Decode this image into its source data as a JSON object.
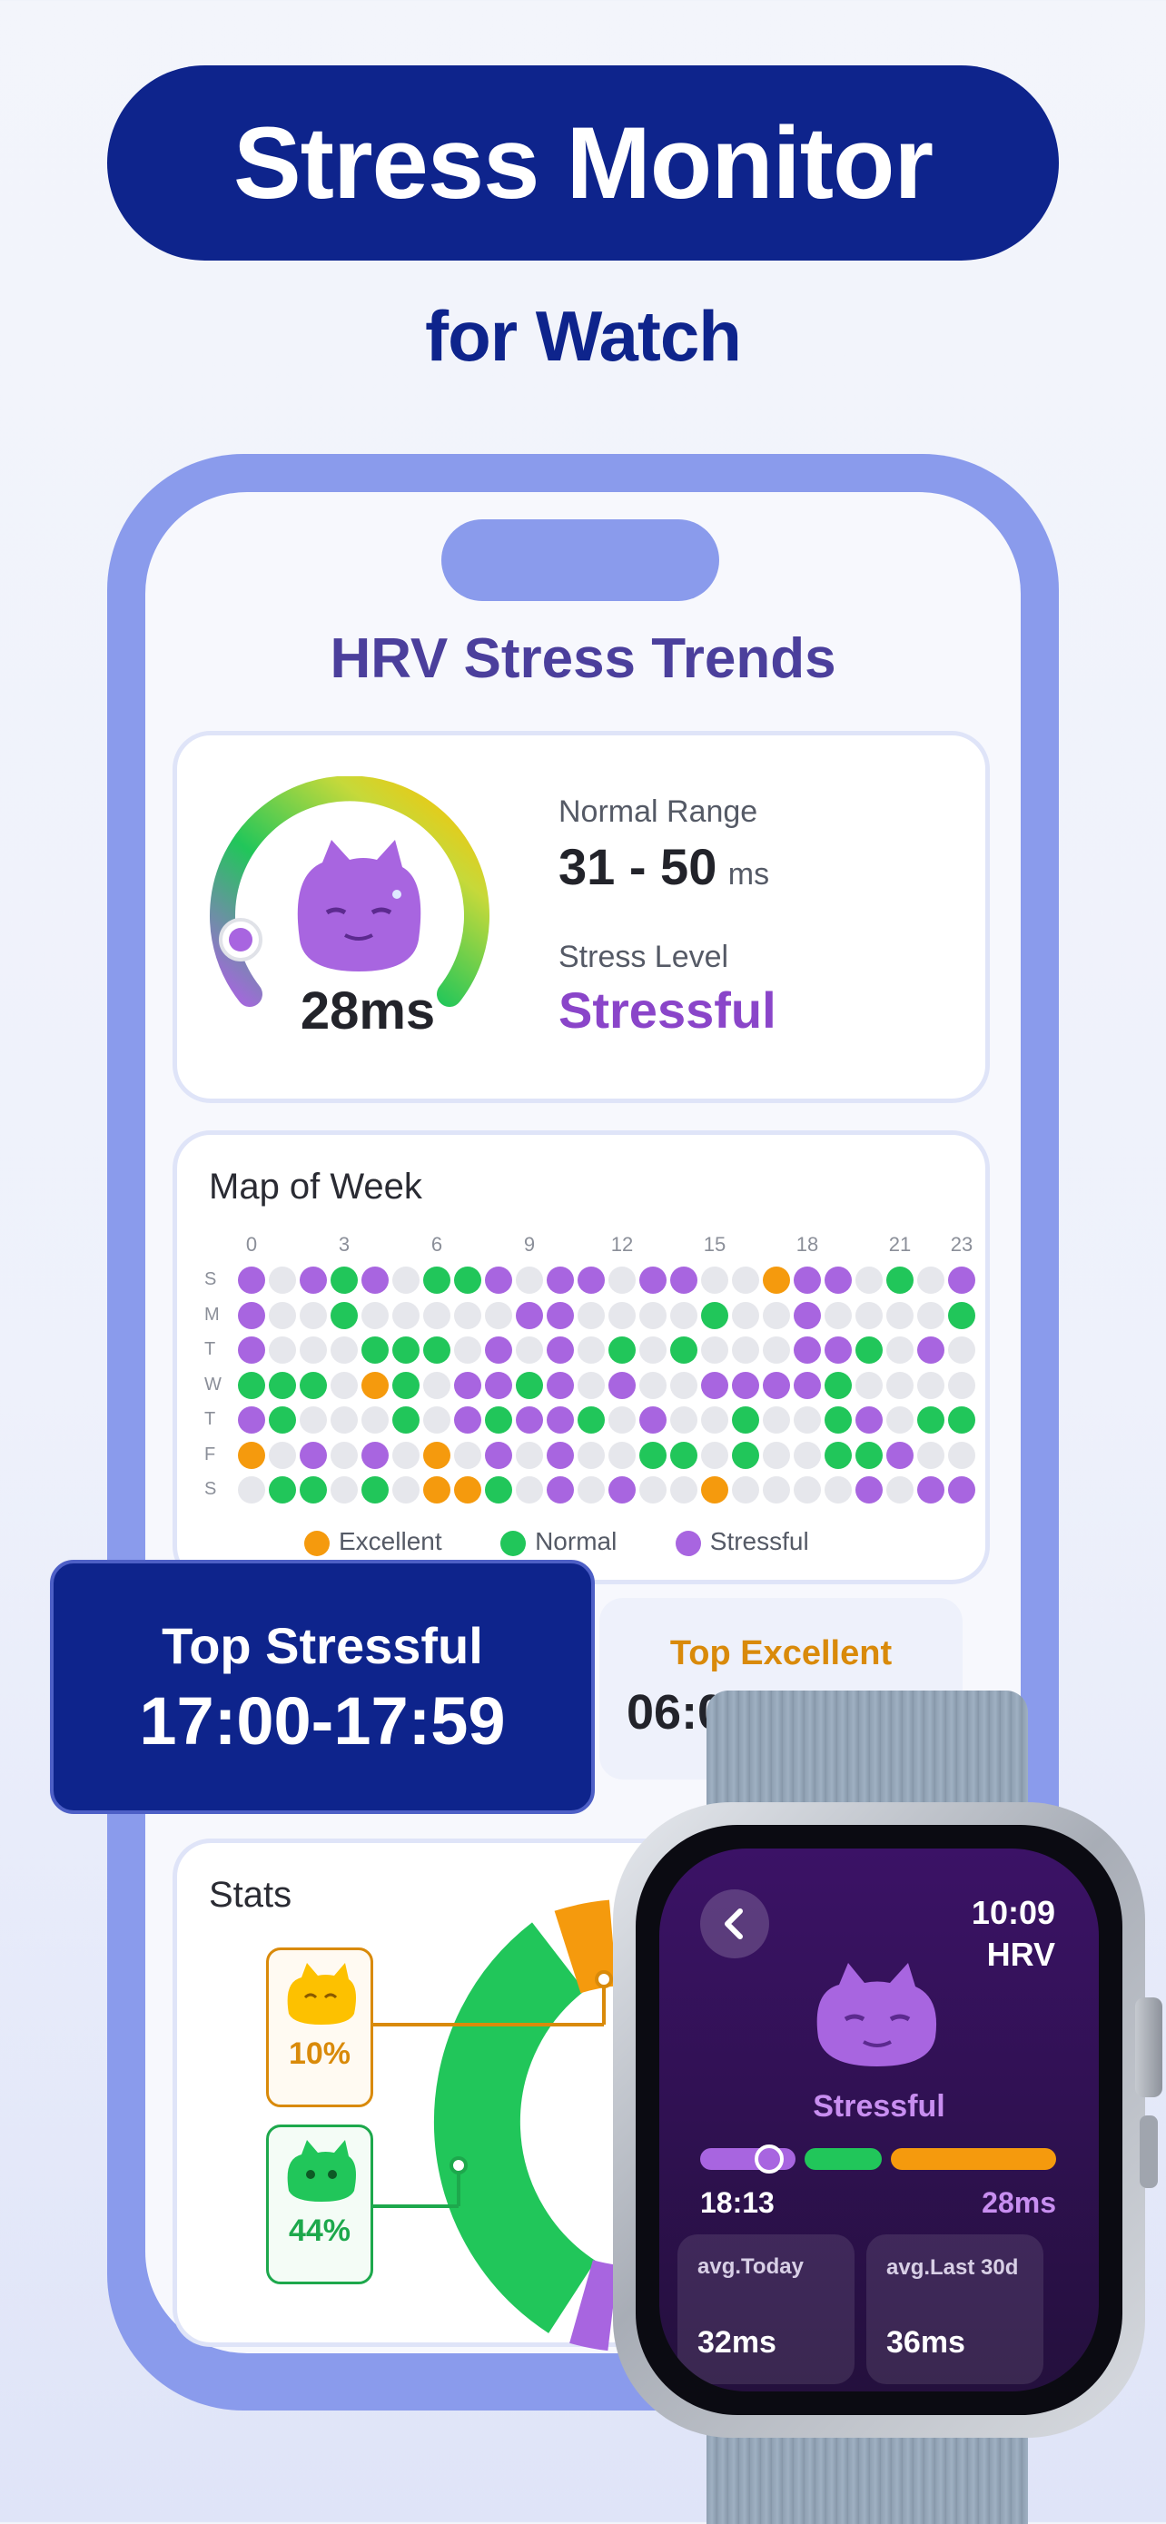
{
  "header": {
    "title": "Stress Monitor",
    "subtitle": "for Watch"
  },
  "screen": {
    "title": "HRV Stress Trends",
    "gauge": {
      "value": "28ms",
      "level_fraction": 0.12
    },
    "normal_range": {
      "label": "Normal Range",
      "value": "31 - 50",
      "unit": "ms"
    },
    "stress_level": {
      "label": "Stress Level",
      "value": "Stressful"
    },
    "map_of_week": {
      "title": "Map of Week",
      "hour_labels": [
        "0",
        "3",
        "6",
        "9",
        "12",
        "15",
        "18",
        "21",
        "23"
      ],
      "day_labels": [
        "S",
        "M",
        "T",
        "W",
        "T",
        "F",
        "S"
      ],
      "legend": {
        "excellent": "Excellent",
        "normal": "Normal",
        "stressful": "Stressful"
      },
      "grid": [
        "SESNSENNSESSESSEEDSSENES",
        "SEENEEEEESSEEEENEESEEEEN",
        "SEEENNNESESENENEEESSNESE",
        "NNNEDNESSNSESEESSSSNEEEE",
        "SNEEENESNSSNESEENEENSENN",
        "DESESEDESESEENNENEENNSEE",
        "ENNENEDDNESESEEDEEEESESS"
      ]
    },
    "top_stressful": {
      "label": "Top Stressful",
      "value": "17:00-17:59"
    },
    "top_excellent": {
      "label": "Top Excellent",
      "value": "06:00-06:59"
    },
    "stats": {
      "title": "Stats",
      "excellent_pct": "10%",
      "normal_pct": "44%"
    }
  },
  "watch": {
    "time": "10:09",
    "mode": "HRV",
    "status": "Stressful",
    "last_time": "18:13",
    "last_value": "28ms",
    "avg_today_label": "avg.Today",
    "avg_today_value": "32ms",
    "avg_last30_label": "avg.Last 30d",
    "avg_last30_value": "36ms"
  },
  "colors": {
    "brand_navy": "#0e248c",
    "excellent": "#f59a0d",
    "normal": "#21c65a",
    "stressful": "#a865e0",
    "empty": "#e6e7ec"
  }
}
